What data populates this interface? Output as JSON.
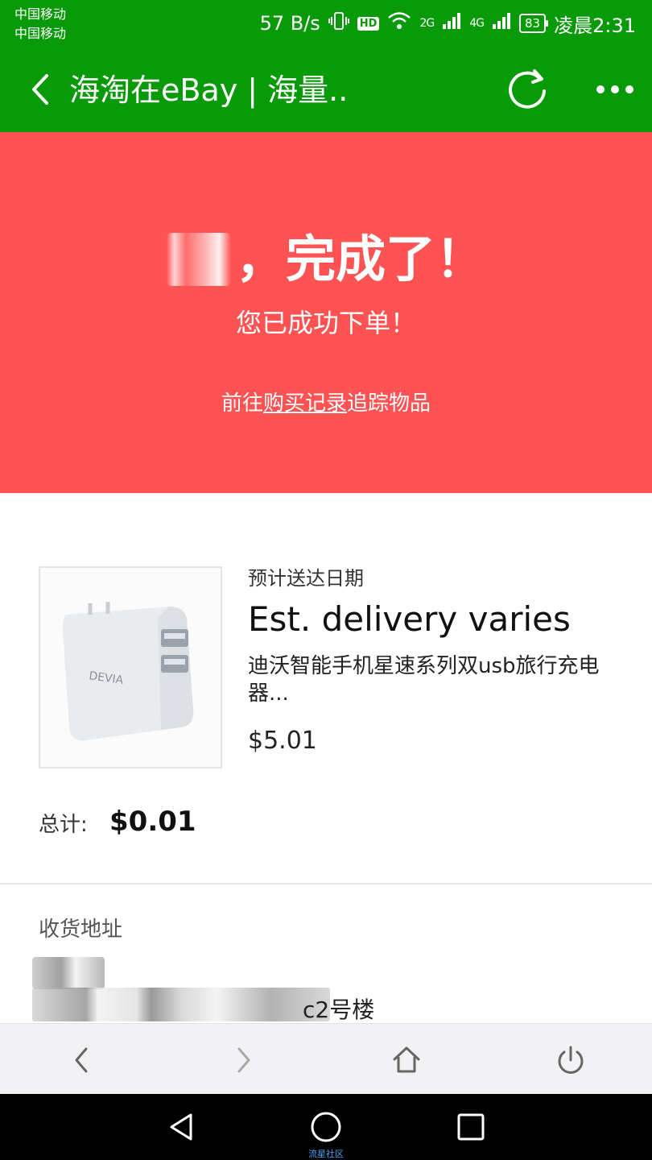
{
  "status_bar": {
    "carrier_1": "中国移动",
    "carrier_2": "中国移动",
    "net_speed": "57 B/s",
    "hd_badge": "HD",
    "sig_2g": "2G",
    "sig_4g": "4G",
    "battery": "83",
    "time": "凌晨2:31"
  },
  "header": {
    "title": "海淘在eBay | 海量..",
    "back_icon": "chevron-left-icon",
    "refresh_icon": "refresh-icon",
    "more_icon": "more-dots-icon",
    "color": "#089a08"
  },
  "banner": {
    "done_text": "，完成了！",
    "order_placed": "您已成功下单！",
    "track_prefix": "前往",
    "track_link": "购买记录",
    "track_suffix": "追踪物品",
    "color": "#ff5252"
  },
  "order": {
    "product_image": "devia-usb-charger-image",
    "image_brand": "DEVIA",
    "eta_label": "预计送达日期",
    "eta_value": "Est. delivery varies",
    "product_title": "迪沃智能手机星速系列双usb旅行充电器...",
    "product_price": "$5.01",
    "total_label": "总计:",
    "total_value": "$0.01"
  },
  "address": {
    "label": "收货地址",
    "line_end": "c2号楼"
  },
  "browser_bar": {
    "back_icon": "browser-back-icon",
    "forward_icon": "browser-forward-icon",
    "home_icon": "home-icon",
    "power_icon": "power-icon"
  },
  "nav_bar": {
    "back_icon": "nav-back-icon",
    "home_icon": "nav-home-icon",
    "recents_icon": "nav-recents-icon"
  },
  "watermark": "流星社区"
}
